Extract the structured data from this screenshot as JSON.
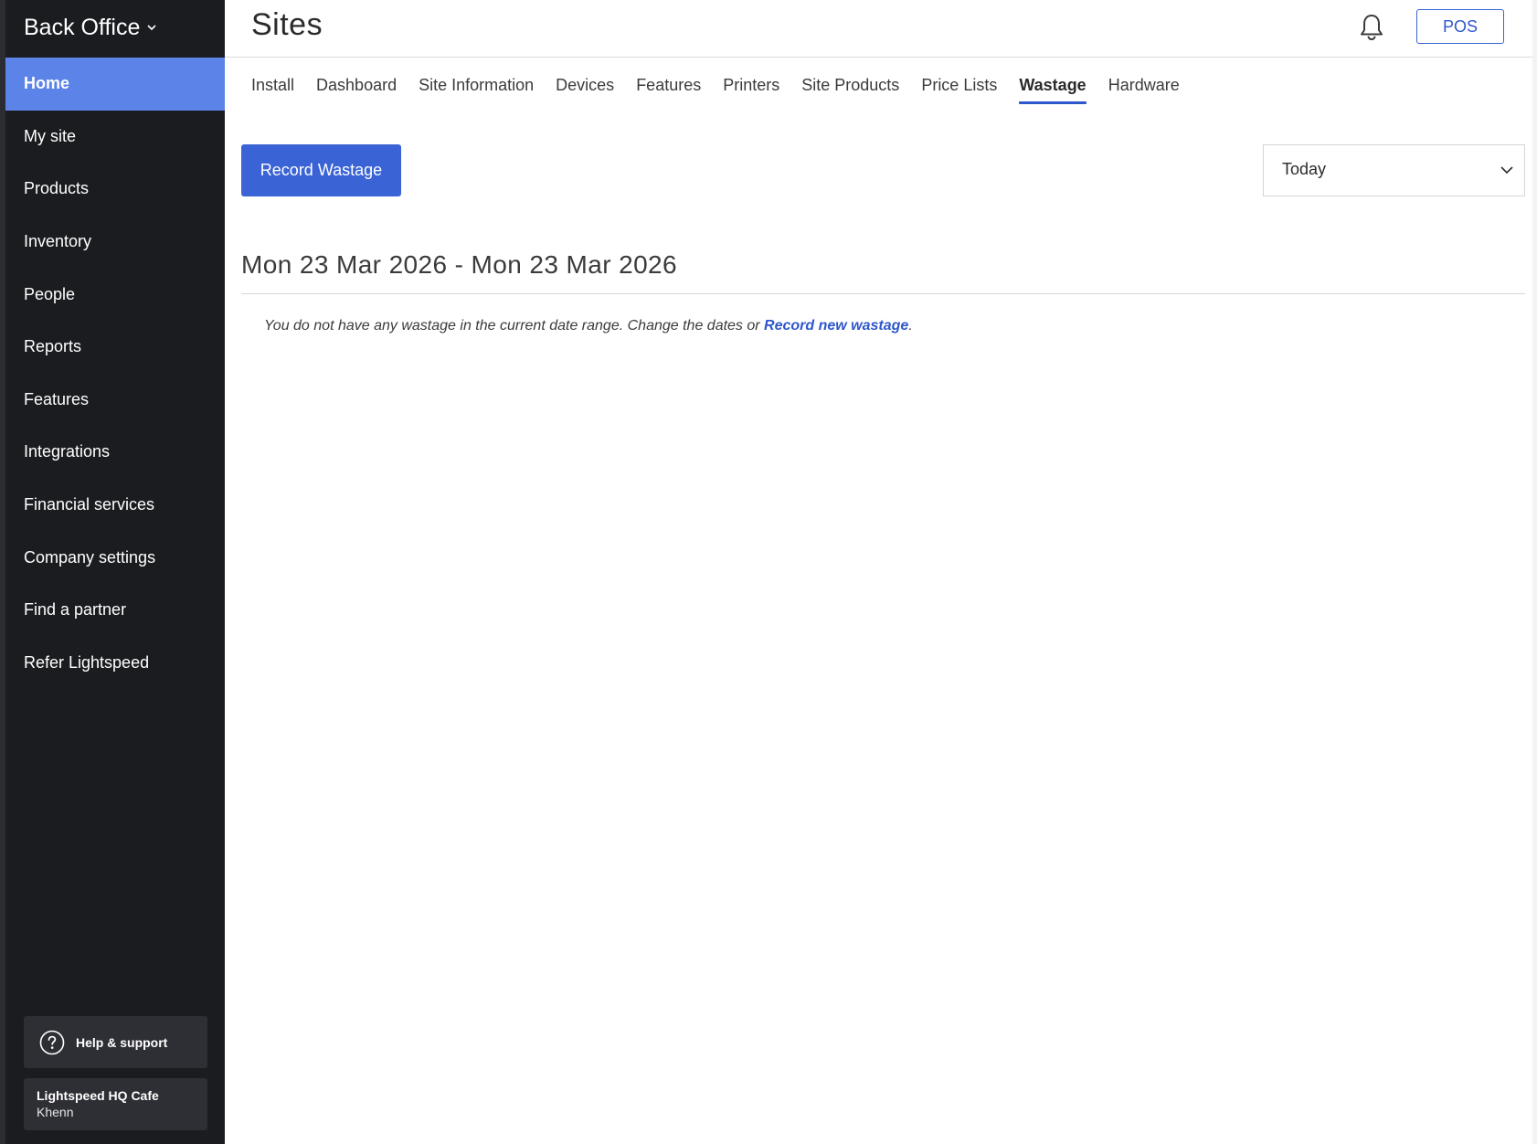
{
  "sidebar": {
    "brand": "Back Office",
    "items": [
      {
        "label": "Home",
        "active": true
      },
      {
        "label": "My site"
      },
      {
        "label": "Products"
      },
      {
        "label": "Inventory"
      },
      {
        "label": "People"
      },
      {
        "label": "Reports"
      },
      {
        "label": "Features"
      },
      {
        "label": "Integrations"
      },
      {
        "label": "Financial services"
      },
      {
        "label": "Company settings"
      },
      {
        "label": "Find a partner"
      },
      {
        "label": "Refer Lightspeed"
      }
    ],
    "help_label": "Help & support",
    "account": {
      "site": "Lightspeed HQ Cafe",
      "user": "Khenn"
    }
  },
  "header": {
    "title": "Sites",
    "pos_label": "POS"
  },
  "tabs": [
    {
      "label": "Install"
    },
    {
      "label": "Dashboard"
    },
    {
      "label": "Site Information"
    },
    {
      "label": "Devices"
    },
    {
      "label": "Features"
    },
    {
      "label": "Printers"
    },
    {
      "label": "Site Products"
    },
    {
      "label": "Price Lists"
    },
    {
      "label": "Wastage",
      "active": true
    },
    {
      "label": "Hardware"
    }
  ],
  "content": {
    "record_button": "Record Wastage",
    "date_filter": "Today",
    "range_title": "Mon 23 Mar 2026 - Mon 23 Mar 2026",
    "empty_message": "You do not have any wastage in the current date range. Change the dates or ",
    "empty_link": "Record new wastage",
    "empty_suffix": "."
  },
  "colors": {
    "sidebar_bg": "#1b1c20",
    "active_nav": "#5b83e8",
    "primary": "#3a63d6"
  }
}
